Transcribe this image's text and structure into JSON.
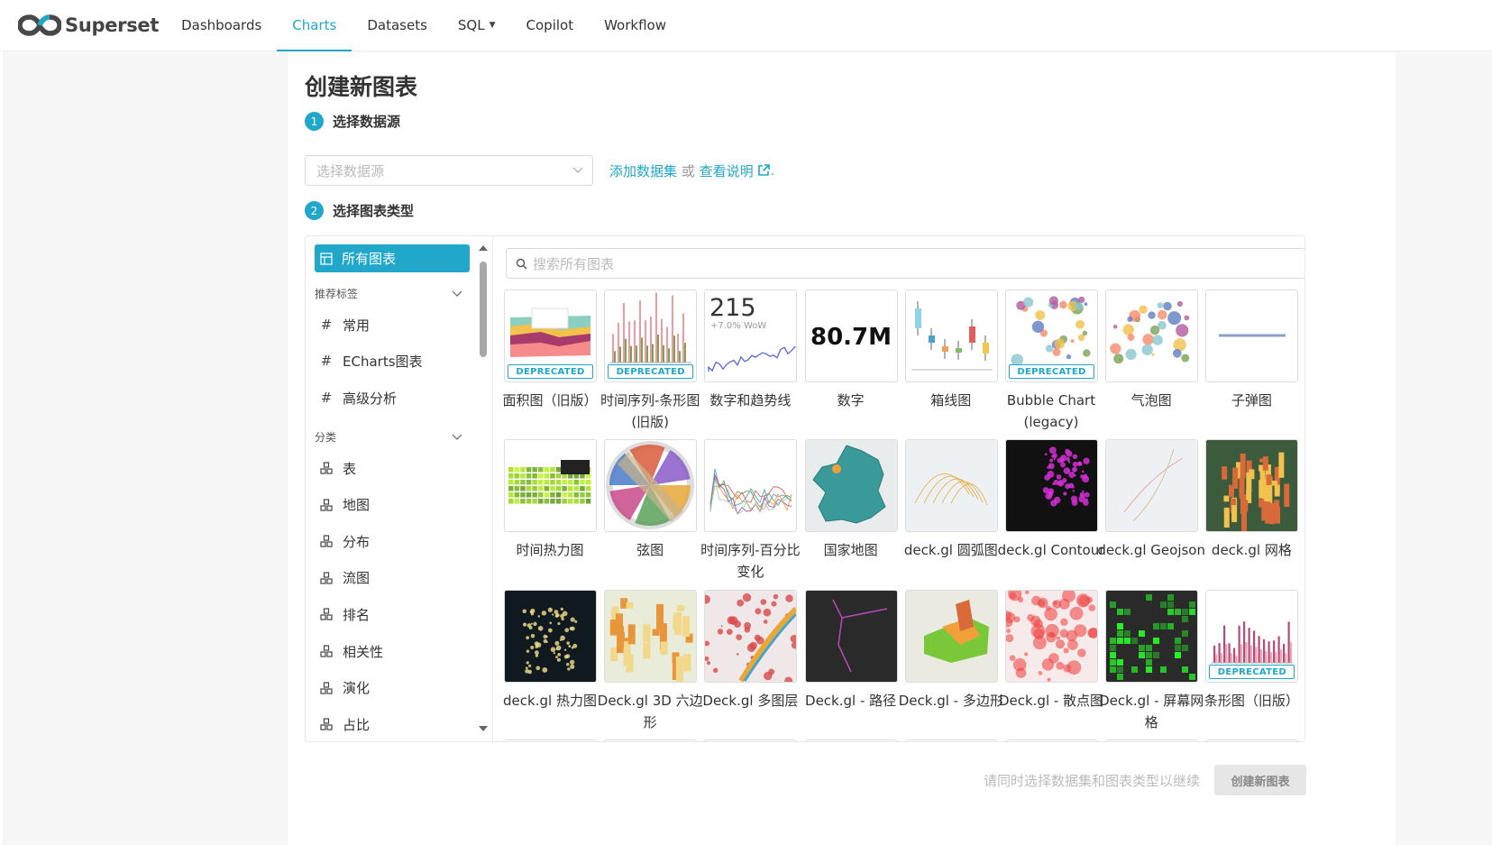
{
  "navbar": {
    "brand": "Superset",
    "items": [
      {
        "label": "Dashboards",
        "active": false
      },
      {
        "label": "Charts",
        "active": true
      },
      {
        "label": "Datasets",
        "active": false
      },
      {
        "label": "SQL",
        "active": false,
        "dropdown": true
      },
      {
        "label": "Copilot",
        "active": false
      },
      {
        "label": "Workflow",
        "active": false
      }
    ]
  },
  "page": {
    "title": "创建新图表",
    "step1": {
      "num": "1",
      "label": "选择数据源"
    },
    "step2": {
      "num": "2",
      "label": "选择图表类型"
    },
    "datasource": {
      "placeholder": "选择数据源"
    },
    "links": {
      "add_dataset": "添加数据集",
      "or": " 或 ",
      "view_docs": "查看说明",
      "period": "."
    }
  },
  "categories": {
    "all_charts": "所有图表",
    "recommended_header": "推荐标签",
    "recommended": [
      "常用",
      "ECharts图表",
      "高级分析"
    ],
    "category_header": "分类",
    "items": [
      "表",
      "地图",
      "分布",
      "流图",
      "排名",
      "相关性",
      "演化",
      "占比"
    ]
  },
  "search": {
    "placeholder": "搜索所有图表"
  },
  "deprecated_label": "DEPRECATED",
  "charts": [
    {
      "name": "面积图（旧版）",
      "deprecated": true,
      "thumb": "area"
    },
    {
      "name": "时间序列-条形图(旧版)",
      "deprecated": true,
      "thumb": "timebar"
    },
    {
      "name": "数字和趋势线",
      "deprecated": false,
      "thumb": "bignumtrend",
      "value": "215",
      "sub": "+7.0% WoW"
    },
    {
      "name": "数字",
      "deprecated": false,
      "thumb": "bignum",
      "value": "80.7M"
    },
    {
      "name": "箱线图",
      "deprecated": false,
      "thumb": "box"
    },
    {
      "name": "Bubble Chart (legacy)",
      "deprecated": true,
      "thumb": "bubblelegacy"
    },
    {
      "name": "气泡图",
      "deprecated": false,
      "thumb": "bubble"
    },
    {
      "name": "子弹图",
      "deprecated": false,
      "thumb": "bullet"
    },
    {
      "name": "时间热力图",
      "deprecated": false,
      "thumb": "calheat"
    },
    {
      "name": "弦图",
      "deprecated": false,
      "thumb": "chord"
    },
    {
      "name": "时间序列-百分比变化",
      "deprecated": false,
      "thumb": "pctchange"
    },
    {
      "name": "国家地图",
      "deprecated": false,
      "thumb": "country"
    },
    {
      "name": "deck.gl 圆弧图",
      "deprecated": false,
      "thumb": "arc"
    },
    {
      "name": "deck.gl Contour",
      "deprecated": false,
      "thumb": "contour"
    },
    {
      "name": "deck.gl Geojson",
      "deprecated": false,
      "thumb": "geojson"
    },
    {
      "name": "deck.gl 网格",
      "deprecated": false,
      "thumb": "grid"
    },
    {
      "name": "deck.gl 热力图",
      "deprecated": false,
      "thumb": "heatmap"
    },
    {
      "name": "Deck.gl 3D 六边形",
      "deprecated": false,
      "thumb": "hex"
    },
    {
      "name": "Deck.gl 多图层",
      "deprecated": false,
      "thumb": "multi"
    },
    {
      "name": "Deck.gl - 路径",
      "deprecated": false,
      "thumb": "path"
    },
    {
      "name": "Deck.gl - 多边形",
      "deprecated": false,
      "thumb": "polygon"
    },
    {
      "name": "Deck.gl - 散点图",
      "deprecated": false,
      "thumb": "scatter"
    },
    {
      "name": "Deck.gl - 屏幕网格",
      "deprecated": false,
      "thumb": "screengrid"
    },
    {
      "name": "条形图（旧版）",
      "deprecated": true,
      "thumb": "barlegacy"
    }
  ],
  "footer": {
    "hint": "请同时选择数据集和图表类型以继续",
    "create_button": "创建新图表"
  },
  "colors": {
    "accent": "#20a7c9"
  }
}
